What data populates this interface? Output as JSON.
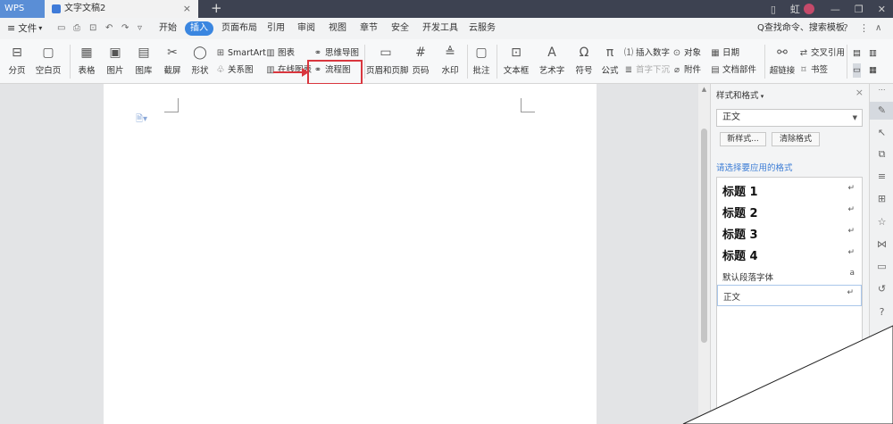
{
  "titlebar": {
    "app_tab": "WPS",
    "doc_tab": "文字文稿2",
    "tab_close": "×",
    "new_tab": "+",
    "user_name": "虹",
    "icons": [
      "tablet-icon",
      "avatar",
      "minimize-icon",
      "restore-icon",
      "close-icon"
    ]
  },
  "menubar": {
    "hamburger": "≡",
    "file_label": "文件",
    "file_caret": "▾",
    "quick_access": {
      "save": "▭",
      "print": "⎙",
      "preview": "⊡",
      "undo": "↶",
      "redo": "↷",
      "more": "▿"
    },
    "tabs": [
      "开始",
      "插入",
      "页面布局",
      "引用",
      "审阅",
      "视图",
      "章节",
      "安全",
      "开发工具",
      "云服务"
    ],
    "active_tab": "插入",
    "search": "Q查找命令、搜索模板",
    "help": "?",
    "more": "⋮",
    "collapse": "∧"
  },
  "ribbon": {
    "page_break": "分页",
    "blank_page": "空白页",
    "table": "表格",
    "picture": "图片",
    "gallery": "图库",
    "screenshot": "截屏",
    "shapes": "形状",
    "smartart": "SmartArt",
    "chart": "图表",
    "mindmap": "思维导图",
    "relation": "关系图",
    "online_chart": "在线图表",
    "flowchart": "流程图",
    "header_footer": "页眉和页脚",
    "page_number": "页码",
    "watermark": "水印",
    "comment": "批注",
    "textbox": "文本框",
    "wordart": "艺术字",
    "symbol": "符号",
    "formula": "公式",
    "insert_number": "插入数字",
    "first_letter": "首字下沉",
    "object": "对象",
    "attachment": "附件",
    "date": "日期",
    "doc_parts": "文档部件",
    "hyperlink": "超链接",
    "cross_ref": "交叉引用",
    "bookmark": "书签"
  },
  "style_panel": {
    "title": "样式和格式",
    "close": "×",
    "current_style": "正文",
    "new_style": "新样式...",
    "clear_format": "清除格式",
    "apply_label": "请选择要应用的格式",
    "styles": [
      {
        "name": "标题 1",
        "mark": "↵"
      },
      {
        "name": "标题 2",
        "mark": "↵"
      },
      {
        "name": "标题 3",
        "mark": "↵"
      },
      {
        "name": "标题 4",
        "mark": "↵"
      },
      {
        "name": "默认段落字体",
        "mark": "a"
      },
      {
        "name": "正文",
        "mark": "↵"
      }
    ]
  },
  "colors": {
    "titlebar": "#3d4251",
    "accent": "#3a86e0",
    "highlight": "#d9363e"
  }
}
